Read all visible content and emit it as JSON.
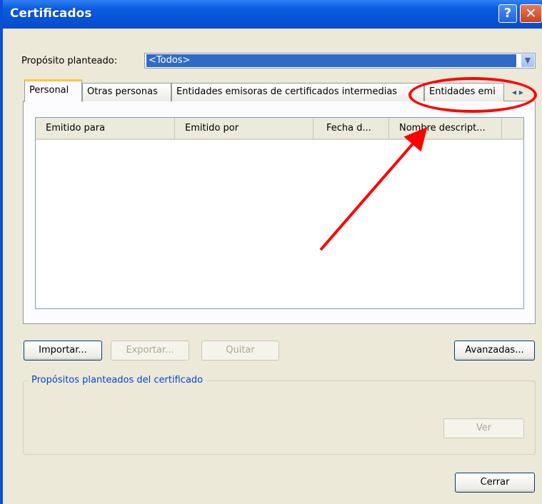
{
  "window": {
    "title": "Certificados",
    "help_glyph": "?",
    "close_glyph": "✕"
  },
  "purpose": {
    "label": "Propósito planteado:",
    "selected": "<Todos>"
  },
  "tabs": [
    {
      "label": "Personal",
      "active": true
    },
    {
      "label": "Otras personas",
      "active": false
    },
    {
      "label": "Entidades emisoras de certificados intermedias",
      "active": false
    },
    {
      "label": "Entidades emi",
      "active": false
    }
  ],
  "tab_scroll_glyphs": "‹ ›",
  "table": {
    "columns": [
      "Emitido para",
      "Emitido por",
      "Fecha d...",
      "Nombre descript..."
    ],
    "rows": []
  },
  "buttons": {
    "import": "Importar...",
    "export": "Exportar...",
    "remove": "Quitar",
    "advanced": "Avanzadas...",
    "view": "Ver",
    "close": "Cerrar"
  },
  "purposes_group": {
    "title": "Propósitos planteados del certificado"
  },
  "colors": {
    "titlebar": "#0653d8",
    "selection": "#316ac5",
    "annotation": "#ff0000",
    "tab_highlight": "#ffc83c"
  },
  "icons": [
    "help-icon",
    "close-icon",
    "dropdown-arrow-icon",
    "tab-scroll-left-icon",
    "tab-scroll-right-icon"
  ]
}
